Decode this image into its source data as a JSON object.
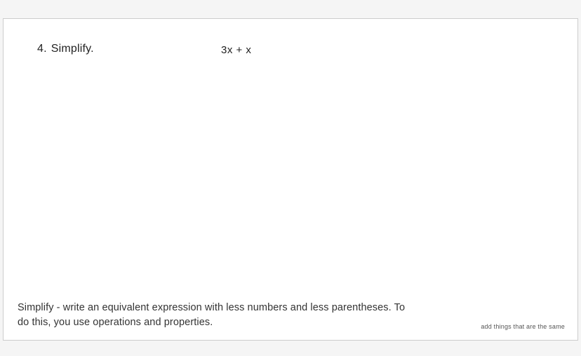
{
  "question": {
    "number": "4.",
    "prompt": "Simplify.",
    "expression": "3x + x"
  },
  "definition": "Simplify - write an equivalent expression with less numbers and less parentheses. To do this, you use operations and properties.",
  "hint": "add things that are the same"
}
